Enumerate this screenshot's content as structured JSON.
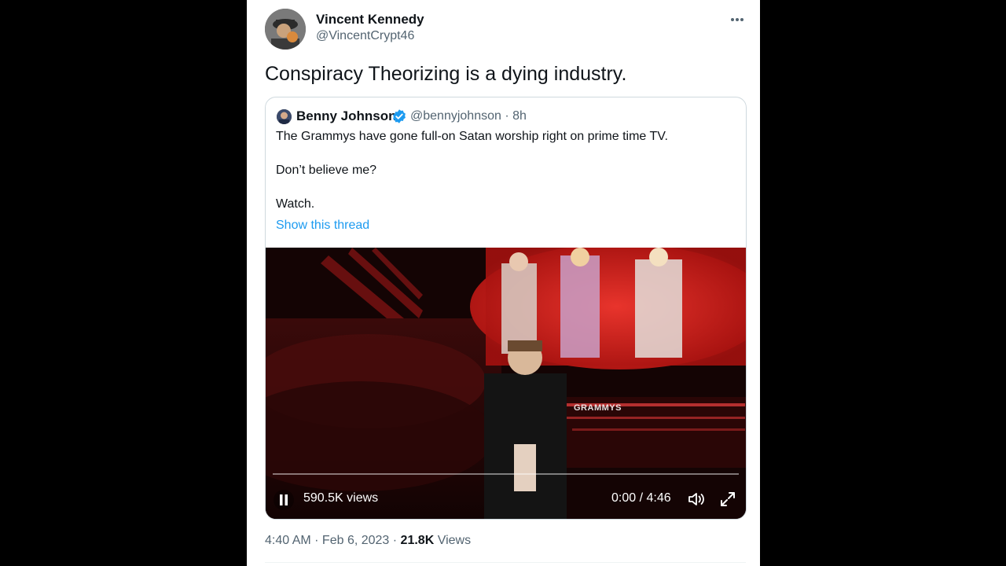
{
  "tweet": {
    "author_name": "Vincent Kennedy",
    "author_handle": "@VincentCrypt46",
    "text": "Conspiracy Theorizing is a dying industry.",
    "timestamp": "4:40 AM · Feb 6, 2023 · ",
    "views_count": "21.8K",
    "views_label": " Views"
  },
  "quote": {
    "author_name": "Benny Johnson",
    "author_handle": "@bennyjohnson · 8h",
    "lines": [
      "The Grammys have gone full-on Satan worship right on prime time TV.",
      "Don’t believe me?",
      "Watch."
    ],
    "show_thread": "Show this thread"
  },
  "video": {
    "views": "590.5K views",
    "time": "0:00 / 4:46",
    "overlay_text": "GRAMMYS",
    "progress": 0.0
  },
  "colors": {
    "link": "#1d9bf0",
    "verified": "#1d9bf0",
    "secondary_text": "#536471"
  }
}
